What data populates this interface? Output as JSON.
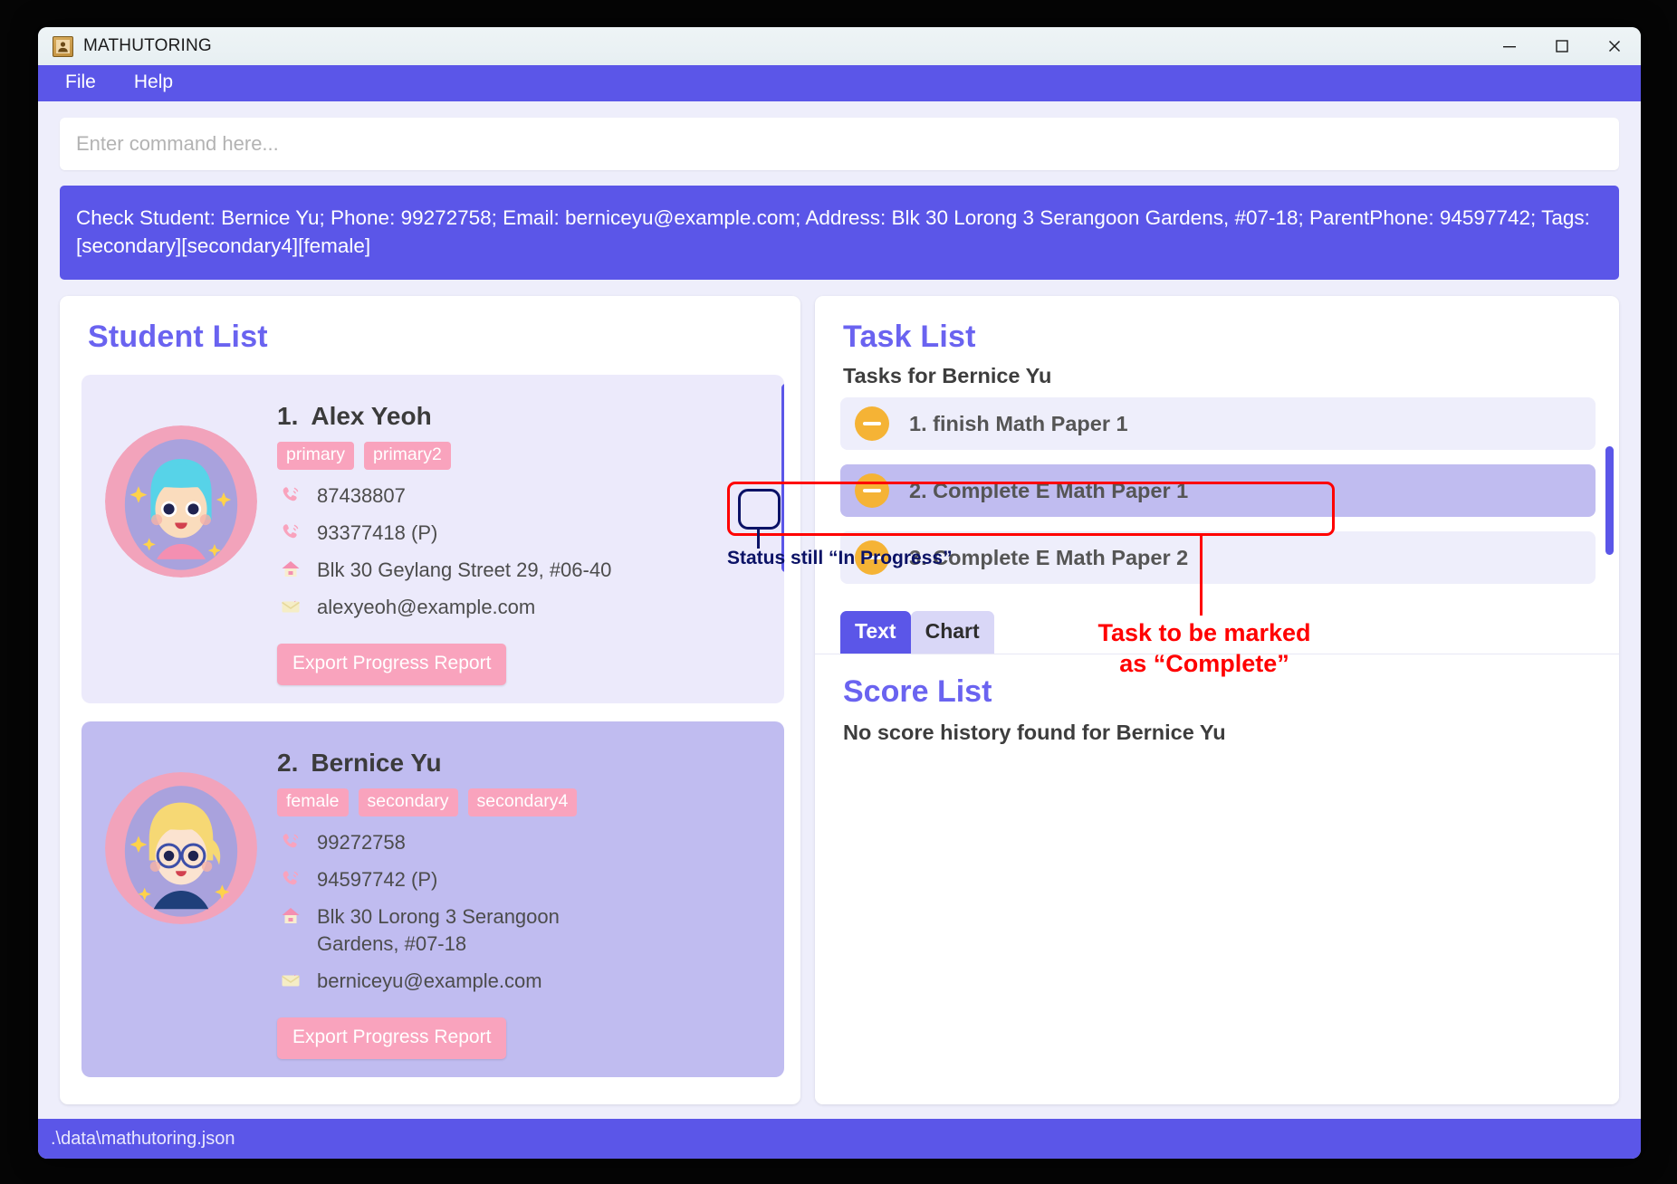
{
  "window": {
    "title": "MATHUTORING",
    "icon": "contact-card-icon",
    "controls": {
      "minimize": "minimize-icon",
      "maximize": "maximize-icon",
      "close": "close-icon"
    }
  },
  "menubar": {
    "items": [
      "File",
      "Help"
    ]
  },
  "command": {
    "placeholder": "Enter command here...",
    "result": "Check Student: Bernice Yu; Phone: 99272758; Email: berniceyu@example.com; Address: Blk 30 Lorong 3 Serangoon Gardens, #07-18; ParentPhone: 94597742; Tags: [secondary][secondary4][female]"
  },
  "student_list": {
    "title": "Student List",
    "export_label": "Export Progress Report",
    "students": [
      {
        "index": "1.",
        "name": "Alex Yeoh",
        "tags": [
          "primary",
          "primary2"
        ],
        "phone": "87438807",
        "parent_phone": "93377418 (P)",
        "address": "Blk 30 Geylang Street 29, #06-40",
        "email": "alexyeoh@example.com"
      },
      {
        "index": "2.",
        "name": "Bernice Yu",
        "tags": [
          "female",
          "secondary",
          "secondary4"
        ],
        "phone": "99272758",
        "parent_phone": "94597742 (P)",
        "address": "Blk 30 Lorong 3 Serangoon Gardens, #07-18",
        "email": "berniceyu@example.com"
      }
    ]
  },
  "task_list": {
    "title": "Task List",
    "subtitle": "Tasks for Bernice Yu",
    "tasks": [
      {
        "label": "1. finish Math Paper 1",
        "status": "in-progress",
        "status_icon": "minus-circle-icon"
      },
      {
        "label": "2. Complete E Math Paper 1",
        "status": "in-progress",
        "status_icon": "minus-circle-icon"
      },
      {
        "label": "3. Complete E Math Paper 2",
        "status": "in-progress",
        "status_icon": "minus-circle-icon"
      }
    ]
  },
  "tabs": {
    "items": [
      "Text",
      "Chart"
    ],
    "selected": "Text"
  },
  "score_list": {
    "title": "Score List",
    "empty_message": "No score history found for Bernice Yu"
  },
  "statusbar": {
    "path": ".\\data\\mathutoring.json"
  },
  "annotations": {
    "status_note": "Status still “In Progress”",
    "task_note_line1": "Task to be marked",
    "task_note_line2": "as “Complete”",
    "highlight_color": "#ff0000",
    "callout_color": "#0b1266"
  }
}
